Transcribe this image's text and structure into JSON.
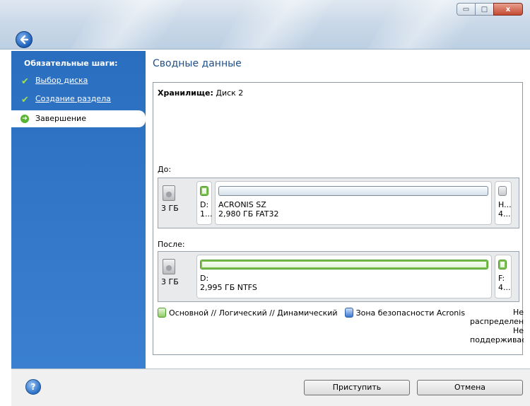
{
  "window": {
    "back_icon": "back-arrow-icon",
    "minimize_glyph": "▭",
    "maximize_glyph": "□",
    "close_glyph": "x"
  },
  "sidebar": {
    "heading": "Обязательные шаги:",
    "steps": [
      {
        "label": "Выбор диска",
        "state": "done"
      },
      {
        "label": "Создание раздела",
        "state": "done"
      },
      {
        "label": "Завершение",
        "state": "current"
      }
    ]
  },
  "main": {
    "title": "Сводные данные",
    "storage_label": "Хранилище:",
    "storage_value": "Диск 2",
    "before_label": "До:",
    "after_label": "После:",
    "before": {
      "disk_size": "3 ГБ",
      "part_d_letter": "D:",
      "part_d_size": "1...",
      "part_acronis_name": "ACRONIS SZ",
      "part_acronis_info": "2,980 ГБ  FAT32",
      "part_h_letter": "H...",
      "part_h_size": "4..."
    },
    "after": {
      "disk_size": "3 ГБ",
      "part_d_letter": "D:",
      "part_d_info": "2,995 ГБ  NTFS",
      "part_f_letter": "F:",
      "part_f_size": "4..."
    },
    "legend": {
      "primary": "Основной // Логический // Динамический",
      "acronis_zone": "Зона безопасности Acronis",
      "unallocated_1": "Не",
      "unallocated_2": "распределен",
      "unsupported_1": "Не",
      "unsupported_2": "поддерживае"
    }
  },
  "footer": {
    "help_glyph": "?",
    "proceed_label": "Приступить",
    "cancel_label": "Отмена"
  },
  "colors": {
    "sidebar": "#2f74c6",
    "title": "#1f4f8a",
    "primary_partition": "#7bc04f",
    "acronis_zone": "#3a78d2"
  }
}
